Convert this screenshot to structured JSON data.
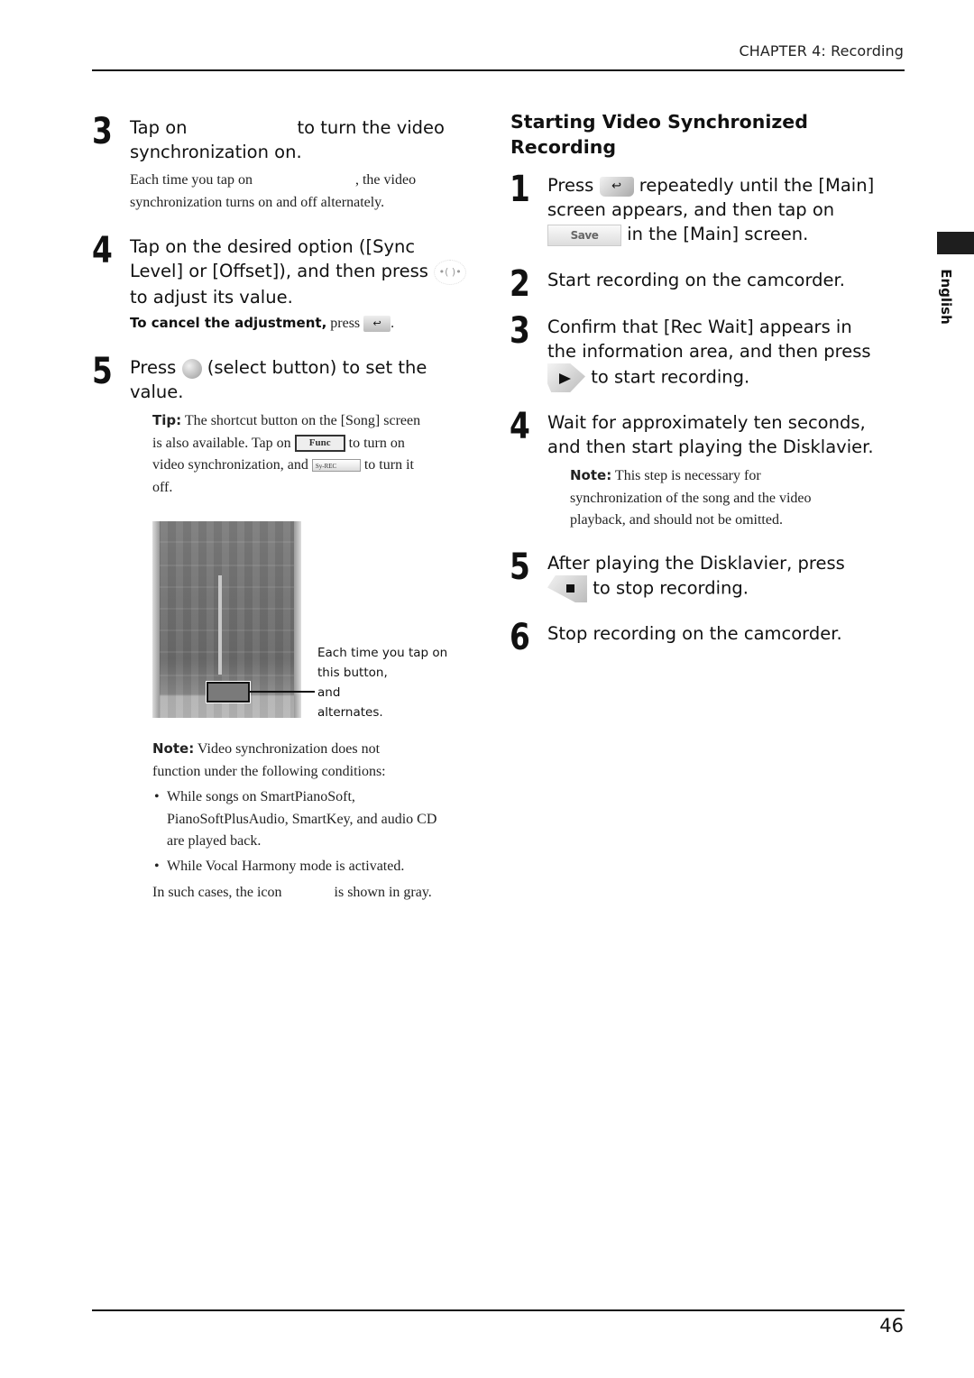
{
  "header": {
    "chapter": "CHAPTER 4: Recording"
  },
  "side_tab": {
    "language": "English"
  },
  "footer": {
    "page_number": "46"
  },
  "left_column": {
    "step3": {
      "number": "3",
      "line1_a": "Tap on",
      "line1_b": "to turn the video",
      "line2": "synchronization on.",
      "detail_a": "Each time you tap on",
      "detail_b": ", the video",
      "detail_c": "synchronization turns on and off alternately."
    },
    "step4": {
      "number": "4",
      "line1": "Tap on the desired option ([Sync",
      "line2": "Level] or [Offset]), and then press",
      "line3": "to adjust its value.",
      "cancel_lead": "To cancel the adjustment,",
      "cancel_text": "press",
      "cancel_end": ".",
      "dial_icon": "•(  )•"
    },
    "step5": {
      "number": "5",
      "line1_a": "Press",
      "line1_b": "(select button) to set the",
      "line2": "value.",
      "tip_lead": "Tip:",
      "tip_line1": "The shortcut button on the [Song] screen",
      "tip_line2_a": "is also available. Tap on",
      "tip_line2_b": "to turn on",
      "tip_line3_a": "video synchronization, and",
      "tip_line3_b": "to turn it",
      "tip_line4": "off.",
      "func_button_label": "Func",
      "syncrec_button_label": "Sy-REC"
    },
    "figure": {
      "callout_lines": [
        "Each time you tap on",
        "this button,",
        "and",
        "alternates."
      ]
    },
    "note": {
      "lead": "Note:",
      "line1": "Video synchronization does not",
      "line2": "function under the following conditions:",
      "bullets": [
        "While songs on SmartPianoSoft, PianoSoftPlusAudio, SmartKey, and audio CD are played back.",
        "While Vocal Harmony mode is activated."
      ],
      "closing_a": "In such cases, the icon",
      "closing_b": "is shown in gray."
    }
  },
  "right_column": {
    "heading_line1": "Starting Video Synchronized",
    "heading_line2": "Recording",
    "steps": [
      {
        "number": "1",
        "line1_a": "Press",
        "line1_b": "repeatedly until the [Main]",
        "line2": "screen appears, and then tap on",
        "line3": "in the [Main] screen.",
        "save_button_label": "Save"
      },
      {
        "number": "2",
        "line1": "Start recording on the camcorder."
      },
      {
        "number": "3",
        "line1": "Confirm that [Rec Wait] appears in",
        "line2": "the information area, and then press",
        "line3": "to start recording."
      },
      {
        "number": "4",
        "line1": "Wait for approximately ten seconds,",
        "line2": "and then start playing the Disklavier.",
        "note_lead": "Note:",
        "note_line1": "This step is necessary for",
        "note_line2": "synchronization of the song and the video",
        "note_line3": "playback, and should not be omitted."
      },
      {
        "number": "5",
        "line1": "After playing the Disklavier, press",
        "line2": "to stop recording."
      },
      {
        "number": "6",
        "line1": "Stop recording on the camcorder."
      }
    ]
  },
  "icons": {
    "back": "↩"
  }
}
